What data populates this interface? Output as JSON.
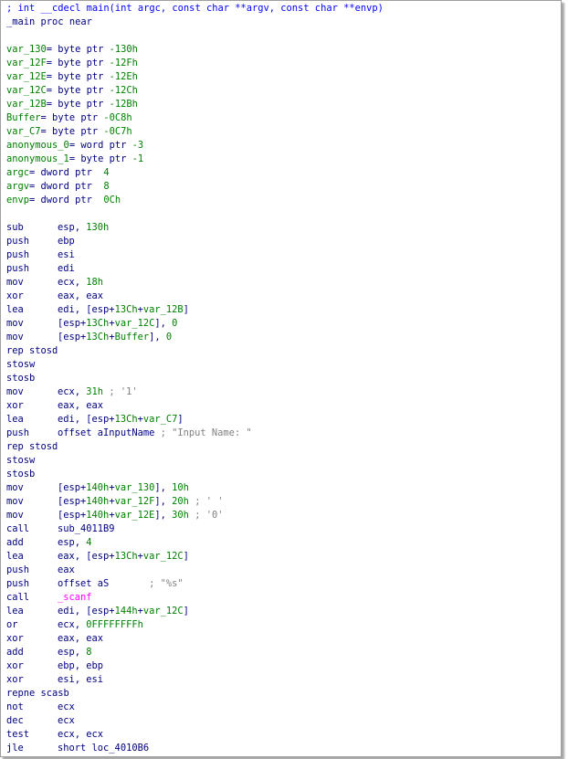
{
  "colors": {
    "comment": "#0000ff",
    "keyword": "#000080",
    "symbol": "#008000",
    "string": "#808080",
    "extern": "#ff00ff",
    "background": "#ffffff"
  },
  "lines": [
    {
      "segs": [
        {
          "t": "; int __cdecl main(int argc, const char **argv, const char **envp)",
          "c": "t-comment"
        }
      ]
    },
    {
      "segs": [
        {
          "t": "_main",
          "c": "t-black"
        },
        {
          "t": " proc near",
          "c": "t-black"
        }
      ]
    },
    {
      "blank": true
    },
    {
      "segs": [
        {
          "t": "var_130",
          "c": "t-green"
        },
        {
          "t": "= byte ptr ",
          "c": "t-black"
        },
        {
          "t": "-130h",
          "c": "t-green"
        }
      ]
    },
    {
      "segs": [
        {
          "t": "var_12F",
          "c": "t-green"
        },
        {
          "t": "= byte ptr ",
          "c": "t-black"
        },
        {
          "t": "-12Fh",
          "c": "t-green"
        }
      ]
    },
    {
      "segs": [
        {
          "t": "var_12E",
          "c": "t-green"
        },
        {
          "t": "= byte ptr ",
          "c": "t-black"
        },
        {
          "t": "-12Eh",
          "c": "t-green"
        }
      ]
    },
    {
      "segs": [
        {
          "t": "var_12C",
          "c": "t-green"
        },
        {
          "t": "= byte ptr ",
          "c": "t-black"
        },
        {
          "t": "-12Ch",
          "c": "t-green"
        }
      ]
    },
    {
      "segs": [
        {
          "t": "var_12B",
          "c": "t-green"
        },
        {
          "t": "= byte ptr ",
          "c": "t-black"
        },
        {
          "t": "-12Bh",
          "c": "t-green"
        }
      ]
    },
    {
      "segs": [
        {
          "t": "Buffer",
          "c": "t-green"
        },
        {
          "t": "= byte ptr ",
          "c": "t-black"
        },
        {
          "t": "-0C8h",
          "c": "t-green"
        }
      ]
    },
    {
      "segs": [
        {
          "t": "var_C7",
          "c": "t-green"
        },
        {
          "t": "= byte ptr ",
          "c": "t-black"
        },
        {
          "t": "-0C7h",
          "c": "t-green"
        }
      ]
    },
    {
      "segs": [
        {
          "t": "anonymous_0",
          "c": "t-green"
        },
        {
          "t": "= word ptr ",
          "c": "t-black"
        },
        {
          "t": "-3",
          "c": "t-green"
        }
      ]
    },
    {
      "segs": [
        {
          "t": "anonymous_1",
          "c": "t-green"
        },
        {
          "t": "= byte ptr ",
          "c": "t-black"
        },
        {
          "t": "-1",
          "c": "t-green"
        }
      ]
    },
    {
      "segs": [
        {
          "t": "argc",
          "c": "t-green"
        },
        {
          "t": "= dword ptr  ",
          "c": "t-black"
        },
        {
          "t": "4",
          "c": "t-green"
        }
      ]
    },
    {
      "segs": [
        {
          "t": "argv",
          "c": "t-green"
        },
        {
          "t": "= dword ptr  ",
          "c": "t-black"
        },
        {
          "t": "8",
          "c": "t-green"
        }
      ]
    },
    {
      "segs": [
        {
          "t": "envp",
          "c": "t-green"
        },
        {
          "t": "= dword ptr  ",
          "c": "t-black"
        },
        {
          "t": "0Ch",
          "c": "t-green"
        }
      ]
    },
    {
      "blank": true
    },
    {
      "mn": "sub",
      "segs": [
        {
          "t": "esp, ",
          "c": "t-black"
        },
        {
          "t": "130h",
          "c": "t-green"
        }
      ]
    },
    {
      "mn": "push",
      "segs": [
        {
          "t": "ebp",
          "c": "t-black"
        }
      ]
    },
    {
      "mn": "push",
      "segs": [
        {
          "t": "esi",
          "c": "t-black"
        }
      ]
    },
    {
      "mn": "push",
      "segs": [
        {
          "t": "edi",
          "c": "t-black"
        }
      ]
    },
    {
      "mn": "mov",
      "segs": [
        {
          "t": "ecx, ",
          "c": "t-black"
        },
        {
          "t": "18h",
          "c": "t-green"
        }
      ]
    },
    {
      "mn": "xor",
      "segs": [
        {
          "t": "eax, eax",
          "c": "t-black"
        }
      ]
    },
    {
      "mn": "lea",
      "segs": [
        {
          "t": "edi, [esp+",
          "c": "t-black"
        },
        {
          "t": "13Ch",
          "c": "t-green"
        },
        {
          "t": "+",
          "c": "t-black"
        },
        {
          "t": "var_12B",
          "c": "t-green"
        },
        {
          "t": "]",
          "c": "t-black"
        }
      ]
    },
    {
      "mn": "mov",
      "segs": [
        {
          "t": "[esp+",
          "c": "t-black"
        },
        {
          "t": "13Ch",
          "c": "t-green"
        },
        {
          "t": "+",
          "c": "t-black"
        },
        {
          "t": "var_12C",
          "c": "t-green"
        },
        {
          "t": "], ",
          "c": "t-black"
        },
        {
          "t": "0",
          "c": "t-green"
        }
      ]
    },
    {
      "mn": "mov",
      "segs": [
        {
          "t": "[esp+",
          "c": "t-black"
        },
        {
          "t": "13Ch",
          "c": "t-green"
        },
        {
          "t": "+",
          "c": "t-black"
        },
        {
          "t": "Buffer",
          "c": "t-green"
        },
        {
          "t": "], ",
          "c": "t-black"
        },
        {
          "t": "0",
          "c": "t-green"
        }
      ]
    },
    {
      "segs": [
        {
          "t": "rep stosd",
          "c": "t-black"
        }
      ]
    },
    {
      "segs": [
        {
          "t": "stosw",
          "c": "t-black"
        }
      ]
    },
    {
      "segs": [
        {
          "t": "stosb",
          "c": "t-black"
        }
      ]
    },
    {
      "mn": "mov",
      "segs": [
        {
          "t": "ecx, ",
          "c": "t-black"
        },
        {
          "t": "31h",
          "c": "t-green"
        },
        {
          "t": " ; '1'",
          "c": "t-gray"
        }
      ]
    },
    {
      "mn": "xor",
      "segs": [
        {
          "t": "eax, eax",
          "c": "t-black"
        }
      ]
    },
    {
      "mn": "lea",
      "segs": [
        {
          "t": "edi, [esp+",
          "c": "t-black"
        },
        {
          "t": "13Ch",
          "c": "t-green"
        },
        {
          "t": "+",
          "c": "t-black"
        },
        {
          "t": "var_C7",
          "c": "t-green"
        },
        {
          "t": "]",
          "c": "t-black"
        }
      ]
    },
    {
      "mn": "push",
      "segs": [
        {
          "t": "offset aInputName",
          "c": "t-black"
        },
        {
          "t": " ; \"Input Name: \"",
          "c": "t-gray"
        }
      ]
    },
    {
      "segs": [
        {
          "t": "rep stosd",
          "c": "t-black"
        }
      ]
    },
    {
      "segs": [
        {
          "t": "stosw",
          "c": "t-black"
        }
      ]
    },
    {
      "segs": [
        {
          "t": "stosb",
          "c": "t-black"
        }
      ]
    },
    {
      "mn": "mov",
      "segs": [
        {
          "t": "[esp+",
          "c": "t-black"
        },
        {
          "t": "140h",
          "c": "t-green"
        },
        {
          "t": "+",
          "c": "t-black"
        },
        {
          "t": "var_130",
          "c": "t-green"
        },
        {
          "t": "], ",
          "c": "t-black"
        },
        {
          "t": "10h",
          "c": "t-green"
        }
      ]
    },
    {
      "mn": "mov",
      "segs": [
        {
          "t": "[esp+",
          "c": "t-black"
        },
        {
          "t": "140h",
          "c": "t-green"
        },
        {
          "t": "+",
          "c": "t-black"
        },
        {
          "t": "var_12F",
          "c": "t-green"
        },
        {
          "t": "], ",
          "c": "t-black"
        },
        {
          "t": "20h",
          "c": "t-green"
        },
        {
          "t": " ; ' '",
          "c": "t-gray"
        }
      ]
    },
    {
      "mn": "mov",
      "segs": [
        {
          "t": "[esp+",
          "c": "t-black"
        },
        {
          "t": "140h",
          "c": "t-green"
        },
        {
          "t": "+",
          "c": "t-black"
        },
        {
          "t": "var_12E",
          "c": "t-green"
        },
        {
          "t": "], ",
          "c": "t-black"
        },
        {
          "t": "30h",
          "c": "t-green"
        },
        {
          "t": " ; '0'",
          "c": "t-gray"
        }
      ]
    },
    {
      "mn": "call",
      "segs": [
        {
          "t": "sub_4011B9",
          "c": "t-black"
        }
      ]
    },
    {
      "mn": "add",
      "segs": [
        {
          "t": "esp, ",
          "c": "t-black"
        },
        {
          "t": "4",
          "c": "t-green"
        }
      ]
    },
    {
      "mn": "lea",
      "segs": [
        {
          "t": "eax, [esp+",
          "c": "t-black"
        },
        {
          "t": "13Ch",
          "c": "t-green"
        },
        {
          "t": "+",
          "c": "t-black"
        },
        {
          "t": "var_12C",
          "c": "t-green"
        },
        {
          "t": "]",
          "c": "t-black"
        }
      ]
    },
    {
      "mn": "push",
      "segs": [
        {
          "t": "eax",
          "c": "t-black"
        }
      ]
    },
    {
      "mn": "push",
      "segs": [
        {
          "t": "offset aS       ",
          "c": "t-black"
        },
        {
          "t": "; \"%s\"",
          "c": "t-gray"
        }
      ]
    },
    {
      "mn": "call",
      "segs": [
        {
          "t": "_scanf",
          "c": "t-ext"
        }
      ]
    },
    {
      "mn": "lea",
      "segs": [
        {
          "t": "edi, [esp+",
          "c": "t-black"
        },
        {
          "t": "144h",
          "c": "t-green"
        },
        {
          "t": "+",
          "c": "t-black"
        },
        {
          "t": "var_12C",
          "c": "t-green"
        },
        {
          "t": "]",
          "c": "t-black"
        }
      ]
    },
    {
      "mn": "or",
      "segs": [
        {
          "t": "ecx, ",
          "c": "t-black"
        },
        {
          "t": "0FFFFFFFFh",
          "c": "t-green"
        }
      ]
    },
    {
      "mn": "xor",
      "segs": [
        {
          "t": "eax, eax",
          "c": "t-black"
        }
      ]
    },
    {
      "mn": "add",
      "segs": [
        {
          "t": "esp, ",
          "c": "t-black"
        },
        {
          "t": "8",
          "c": "t-green"
        }
      ]
    },
    {
      "mn": "xor",
      "segs": [
        {
          "t": "ebp, ebp",
          "c": "t-black"
        }
      ]
    },
    {
      "mn": "xor",
      "segs": [
        {
          "t": "esi, esi",
          "c": "t-black"
        }
      ]
    },
    {
      "segs": [
        {
          "t": "repne scasb",
          "c": "t-black"
        }
      ]
    },
    {
      "mn": "not",
      "segs": [
        {
          "t": "ecx",
          "c": "t-black"
        }
      ]
    },
    {
      "mn": "dec",
      "segs": [
        {
          "t": "ecx",
          "c": "t-black"
        }
      ]
    },
    {
      "mn": "test",
      "segs": [
        {
          "t": "ecx, ecx",
          "c": "t-black"
        }
      ]
    },
    {
      "mn": "jle",
      "segs": [
        {
          "t": "short loc_4010B6",
          "c": "t-black"
        }
      ]
    }
  ]
}
